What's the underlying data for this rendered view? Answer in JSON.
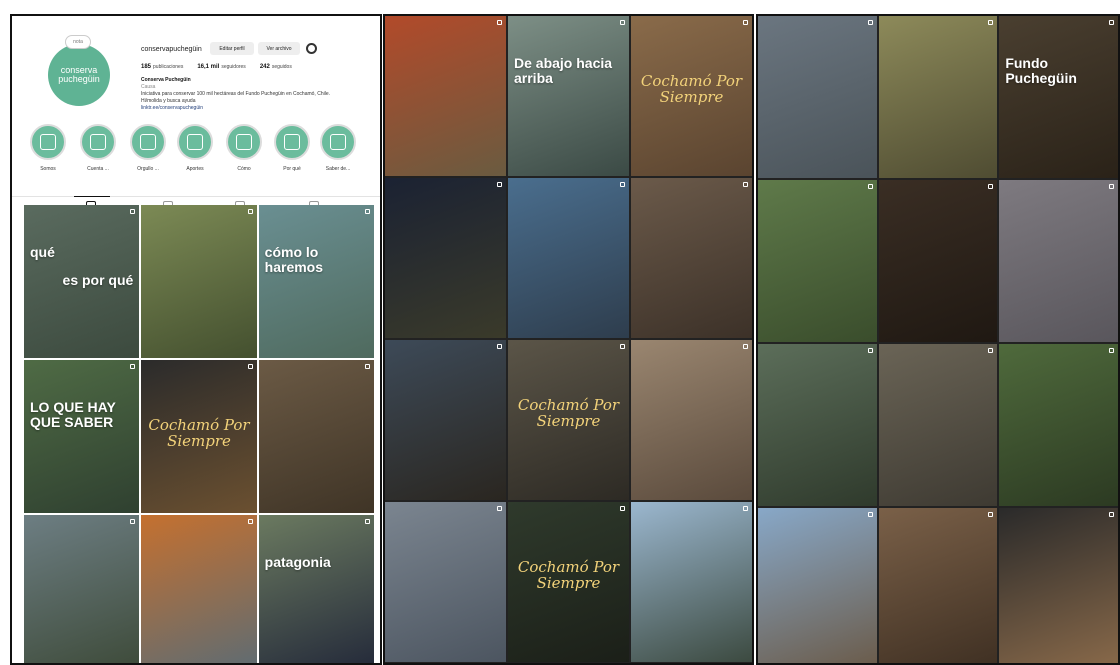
{
  "profile": {
    "avatar_line1": "conserva",
    "avatar_line2": "puchegüin",
    "avatar_badge": "nota",
    "username": "conservapuchegüin",
    "edit_label": "Editar perfil",
    "archive_label": "Ver archivo",
    "stats": [
      {
        "value": "185",
        "label": "publicaciones"
      },
      {
        "value": "16,1 mil",
        "label": "seguidores"
      },
      {
        "value": "242",
        "label": "seguidos"
      }
    ],
    "bio": {
      "name": "Conserva Puchegüin",
      "category": "Causa",
      "line1": "Iniciativa para conservar 100 mil hectáreas del Fundo Puchegüin en Cochamó, Chile.",
      "line2": "Hi/molida y busca ayuda",
      "link": "linktr.ee/conservapuchegüin"
    },
    "highlights": [
      "Somos",
      "Cuenta ...",
      "Orgullo ...",
      "Aportes",
      "Cómo",
      "Por qué",
      "Saber de..."
    ]
  },
  "grid1": [
    {
      "title": "qué",
      "title2": "es por qué",
      "bg": "#5a6b5f",
      "bg2": "#3c4a3e"
    },
    {
      "title": "",
      "bg": "#7c8a55",
      "bg2": "#44502f"
    },
    {
      "title": "cómo lo haremos",
      "bg": "#6a8f92",
      "bg2": "#4f6a5e"
    },
    {
      "title": "LO QUE HAY QUE SABER",
      "bg": "#4f6b45",
      "bg2": "#2f4030"
    },
    {
      "script": "Cochamó Por Siempre",
      "bg": "#2b2b2b",
      "bg2": "#6b5030"
    },
    {
      "title": "",
      "bg": "#6b5a45",
      "bg2": "#3f3426"
    },
    {
      "title": "",
      "bg": "#6d7e83",
      "bg2": "#3e4b3a"
    },
    {
      "title": "",
      "bg": "#c5702f",
      "bg2": "#5f6c72"
    },
    {
      "title": "patagonia",
      "bg": "#6b7a60",
      "bg2": "#242a3a"
    }
  ],
  "grid2": [
    {
      "title": "",
      "bg": "#b24a2a",
      "bg2": "#6a5b40"
    },
    {
      "title": "De abajo hacia arriba",
      "bg": "#7d8f86",
      "bg2": "#3b4a45"
    },
    {
      "script": "Cochamó Por Siempre",
      "bg": "#8a6b4a",
      "bg2": "#5a4430"
    },
    {
      "title": "",
      "bg": "#1b2233",
      "bg2": "#3a3a2a"
    },
    {
      "title": "",
      "bg": "#4a6e8e",
      "bg2": "#2e3d4d"
    },
    {
      "title": "",
      "bg": "#6b5a4a",
      "bg2": "#3c3128"
    },
    {
      "title": "",
      "bg": "#3d4a58",
      "bg2": "#2a2620"
    },
    {
      "script": "Cochamó Por Siempre",
      "bg": "#5b5548",
      "bg2": "#2d2a24"
    },
    {
      "title": "",
      "bg": "#9a8670",
      "bg2": "#5a4a3c"
    },
    {
      "title": "",
      "bg": "#7b8590",
      "bg2": "#4c5560"
    },
    {
      "script": "Cochamó Por Siempre",
      "bg": "#2f3a2c",
      "bg2": "#1b1f18"
    },
    {
      "title": "",
      "bg": "#9bb7cf",
      "bg2": "#3c4a40"
    }
  ],
  "grid3": [
    {
      "title": "",
      "bg": "#6b7680",
      "bg2": "#4a5359"
    },
    {
      "title": "",
      "bg": "#8d8a5a",
      "bg2": "#4f4c32"
    },
    {
      "title": "Fundo Puchegüin",
      "bg": "#4a3f30",
      "bg2": "#2a2218"
    },
    {
      "title": "",
      "bg": "#5f7a4a",
      "bg2": "#3a4d2c"
    },
    {
      "title": "",
      "bg": "#3a2e24",
      "bg2": "#1f1812"
    },
    {
      "title": "",
      "bg": "#7e7a80",
      "bg2": "#59565c"
    },
    {
      "title": "",
      "bg": "#5c6e5a",
      "bg2": "#2f3a2c"
    },
    {
      "title": "",
      "bg": "#6a6456",
      "bg2": "#3e3a32"
    },
    {
      "title": "",
      "bg": "#4f6a3c",
      "bg2": "#2c3a22"
    },
    {
      "title": "",
      "bg": "#88a8c8",
      "bg2": "#6a5a48"
    },
    {
      "title": "",
      "bg": "#7a6048",
      "bg2": "#3e2f22"
    },
    {
      "title": "",
      "bg": "#2a2a2a",
      "bg2": "#8a6a4a"
    }
  ]
}
